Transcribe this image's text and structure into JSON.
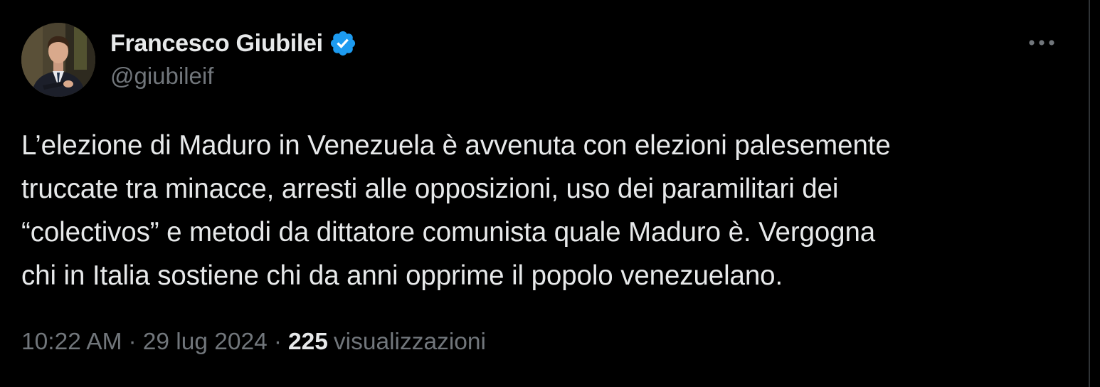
{
  "author": {
    "display_name": "Francesco Giubilei",
    "handle": "@giubileif",
    "verified": true,
    "avatar_icon": "profile-photo"
  },
  "tweet": {
    "text": "L’elezione di Maduro in Venezuela è avvenuta con elezioni palesemente\ntruccate tra minacce, arresti alle opposizioni, uso dei paramilitari dei\n“colectivos” e metodi da dittatore comunista quale Maduro è. Vergogna\nchi in Italia sostiene chi da anni opprime il popolo venezuelano.",
    "time": "10:22 AM",
    "separator": "·",
    "date": "29 lug 2024",
    "views_count": "225",
    "views_label": "visualizzazioni"
  },
  "menu": {
    "more_icon": "more-horizontal-icon"
  },
  "colors": {
    "background": "#000000",
    "primary_text": "#e7e9ea",
    "secondary_text": "#71767b",
    "verified_blue": "#1d9bf0",
    "divider": "#2f3336"
  }
}
